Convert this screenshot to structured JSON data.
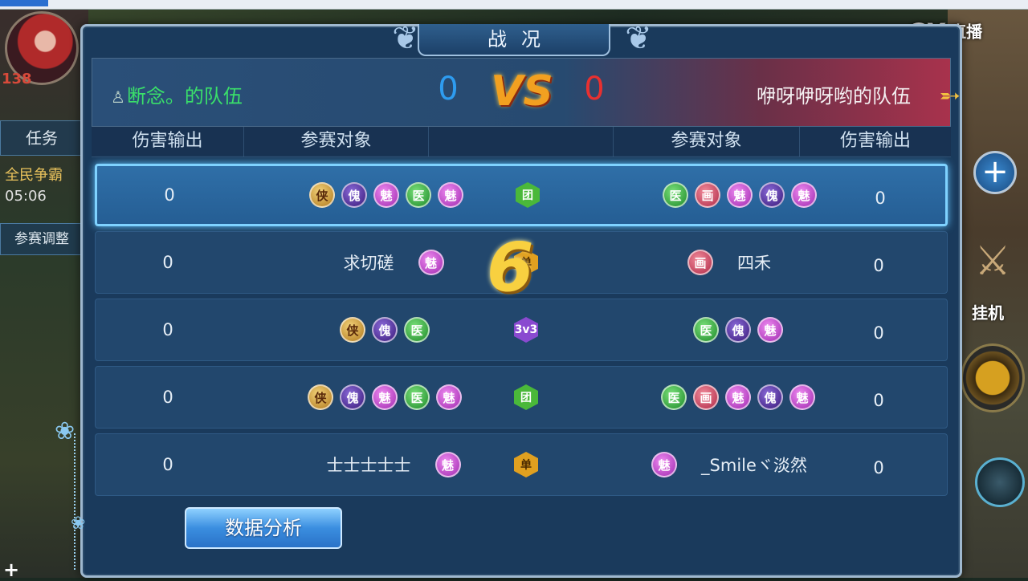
{
  "hud": {
    "level": "138",
    "task_label": "任务",
    "quest_label": "全民争霸",
    "quest_time": "05:06",
    "adjust_label": "参赛调整",
    "hang_label": "挂机",
    "watermark": "直播",
    "watermark_cx": "CX"
  },
  "dialog": {
    "title": "战况",
    "team_left": "断念。的队伍",
    "team_right": "咿呀咿呀哟的队伍",
    "score_left": "0",
    "score_right": "0",
    "vs": "VS",
    "headers": {
      "dmg_left": "伤害输出",
      "target_left": "参赛对象",
      "target_right": "参赛对象",
      "dmg_right": "伤害输出"
    },
    "rows": [
      {
        "dmg_left": "0",
        "mode": "团",
        "dmg_right": "0",
        "left_icons": [
          "侠",
          "傀",
          "魅",
          "医",
          "魅"
        ],
        "right_icons": [
          "医",
          "画",
          "魅",
          "傀",
          "魅"
        ]
      },
      {
        "dmg_left": "0",
        "mode": "单",
        "dmg_right": "0",
        "left_name": "求切磋",
        "left_icons": [
          "魅"
        ],
        "right_name": "四禾",
        "right_icons": [
          "画"
        ]
      },
      {
        "dmg_left": "0",
        "mode": "3v3",
        "dmg_right": "0",
        "left_icons": [
          "侠",
          "傀",
          "医"
        ],
        "right_icons": [
          "医",
          "傀",
          "魅"
        ]
      },
      {
        "dmg_left": "0",
        "mode": "团",
        "dmg_right": "0",
        "left_icons": [
          "侠",
          "傀",
          "魅",
          "医",
          "魅"
        ],
        "right_icons": [
          "医",
          "画",
          "魅",
          "傀",
          "魅"
        ]
      },
      {
        "dmg_left": "0",
        "mode": "单",
        "dmg_right": "0",
        "left_name": "士士士士士",
        "left_icons": [
          "魅"
        ],
        "right_name": "_Smileヾ淡然",
        "right_icons": [
          "魅"
        ]
      }
    ],
    "round_indicator": "6",
    "analysis_button": "数据分析"
  },
  "colors": {
    "accent_blue": "#2e9cf0",
    "accent_red": "#e83030",
    "team_left_green": "#3ae06a",
    "selected_border": "#7fd2ff"
  }
}
